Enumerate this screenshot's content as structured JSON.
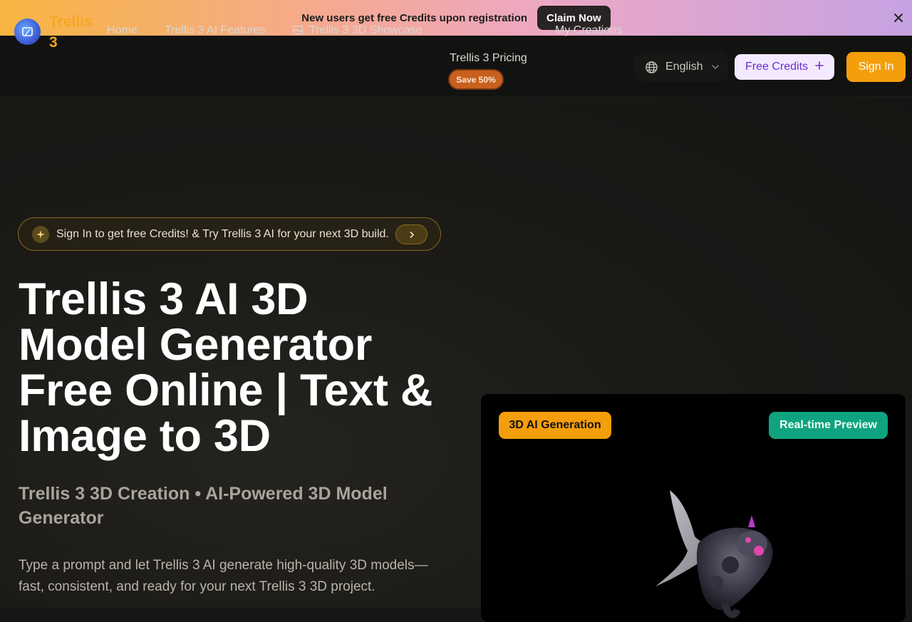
{
  "promo": {
    "text": "New users get free Credits upon registration",
    "button": "Claim Now",
    "close_icon": "close-icon"
  },
  "nav": {
    "brand": "Trellis 3",
    "links": [
      {
        "label": "Home"
      },
      {
        "label": "Trellis 3 AI Features"
      },
      {
        "label": "Trellis 3 3D Showcase",
        "icon": "gallery-icon"
      },
      {
        "label": "Trellis 3 Pricing",
        "badge": "Save 50%"
      },
      {
        "label": "My Creations"
      }
    ],
    "language": "English",
    "free_credits": "Free Credits",
    "sign_in": "Sign In"
  },
  "hero": {
    "announcement": "Sign In to get free Credits! & Try Trellis 3 AI for your next 3D build.",
    "title": "Trellis 3 AI 3D Model Generator Free Online | Text & Image to 3D",
    "subtitle": "Trellis 3 3D Creation • AI-Powered 3D Model Generator",
    "description": "Type a prompt and let Trellis 3 AI generate high-quality 3D models—fast, consistent, and ready for your next Trellis 3 3D project."
  },
  "preview": {
    "tag_left": "3D AI Generation",
    "tag_right": "Real-time Preview"
  },
  "colors": {
    "accent": "#f59e0b",
    "brand": "#f5a623",
    "preview_tag": "#10a37f",
    "credits_text": "#6b2fd6"
  }
}
